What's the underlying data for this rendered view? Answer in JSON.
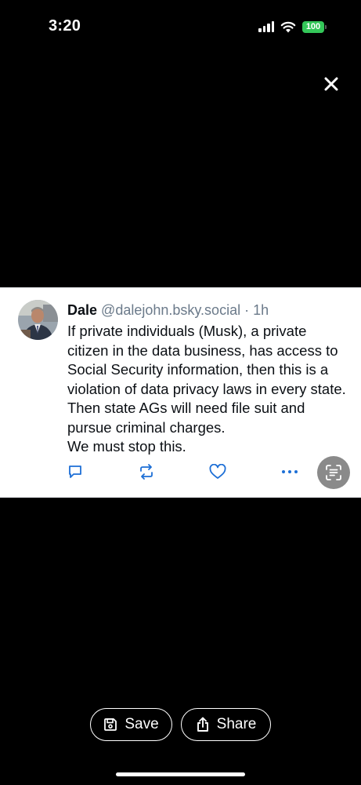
{
  "status_bar": {
    "time": "3:20",
    "battery_level": "100",
    "battery_color": "#34c759",
    "icons": [
      "cellular-signal-icon",
      "wifi-icon",
      "battery-icon"
    ]
  },
  "viewer": {
    "close_icon": "close-icon"
  },
  "post": {
    "author_name": "Dale",
    "author_handle": "@dalejohn.bsky.social · 1h",
    "text": "If private individuals (Musk), a private citizen in the data business, has access to Social Security information, then this is a violation of data privacy laws in every state. Then state AGs will need file suit and pursue criminal charges.\nWe must stop this.",
    "actions": [
      "reply-icon",
      "repost-icon",
      "like-icon",
      "more-options-icon"
    ],
    "handle_color": "#6b7a8a",
    "action_color": "#1d6fd6"
  },
  "scan_button": {
    "icon": "live-text-scan-icon"
  },
  "bottom_actions": {
    "save_label": "Save",
    "share_label": "Share"
  }
}
